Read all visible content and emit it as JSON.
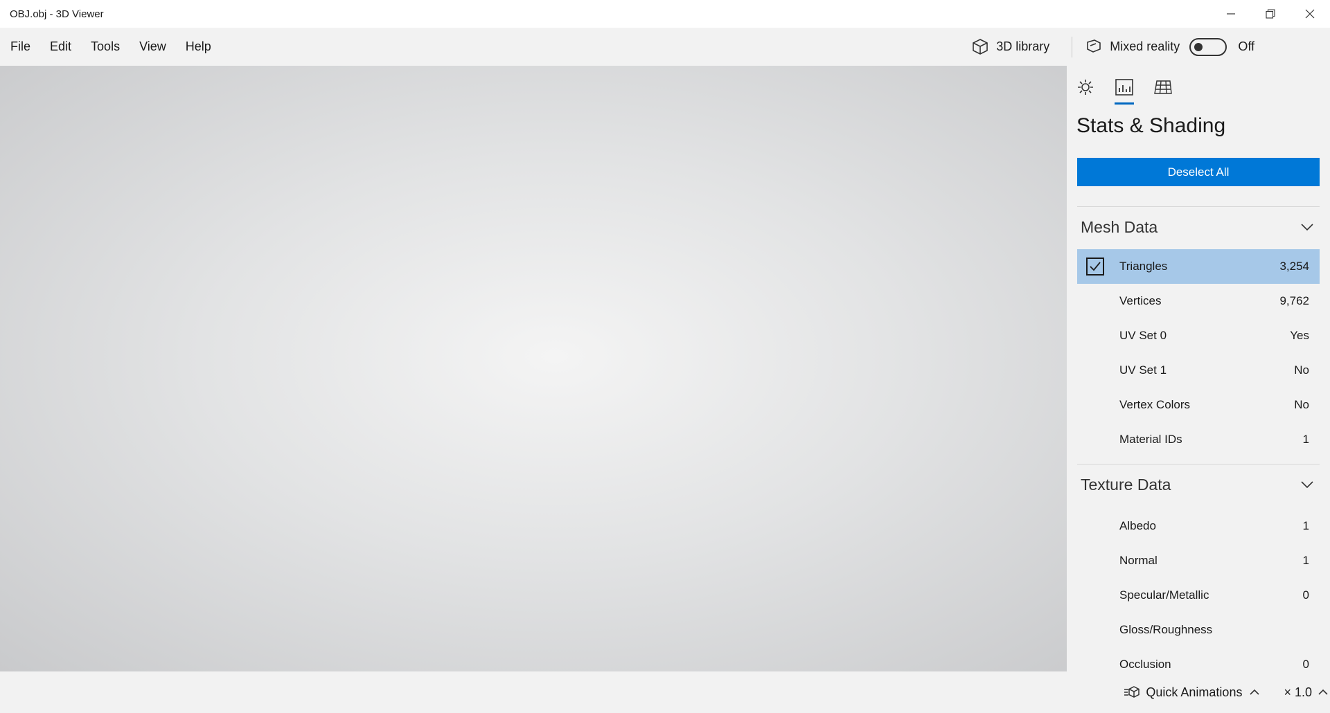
{
  "window": {
    "title": "OBJ.obj - 3D Viewer"
  },
  "menu": {
    "items": [
      "File",
      "Edit",
      "Tools",
      "View",
      "Help"
    ]
  },
  "toolbar": {
    "library_label": "3D library",
    "mixed_reality_label": "Mixed reality",
    "mixed_reality_state": "Off",
    "mixed_reality_on": false
  },
  "viewport": {
    "content_note": "Model view omitted"
  },
  "panel": {
    "tabs": [
      "lighting-icon",
      "stats-icon",
      "grid-icon"
    ],
    "active_tab": "stats-icon",
    "title": "Stats & Shading",
    "deselect_label": "Deselect All",
    "mesh_section": {
      "label": "Mesh Data",
      "rows": [
        {
          "name": "Triangles",
          "value": "3,254",
          "checked": true
        },
        {
          "name": "Vertices",
          "value": "9,762"
        },
        {
          "name": "UV Set 0",
          "value": "Yes"
        },
        {
          "name": "UV Set 1",
          "value": "No"
        },
        {
          "name": "Vertex Colors",
          "value": "No"
        },
        {
          "name": "Material IDs",
          "value": "1"
        }
      ]
    },
    "texture_section": {
      "label": "Texture Data",
      "rows": [
        {
          "name": "Albedo",
          "value": "1"
        },
        {
          "name": "Normal",
          "value": "1"
        },
        {
          "name": "Specular/Metallic",
          "value": "0"
        },
        {
          "name": "Gloss/Roughness",
          "value": ""
        },
        {
          "name": "Occlusion",
          "value": "0"
        }
      ]
    }
  },
  "status": {
    "animations_label": "Quick Animations",
    "speed_label": "× 1.0"
  }
}
